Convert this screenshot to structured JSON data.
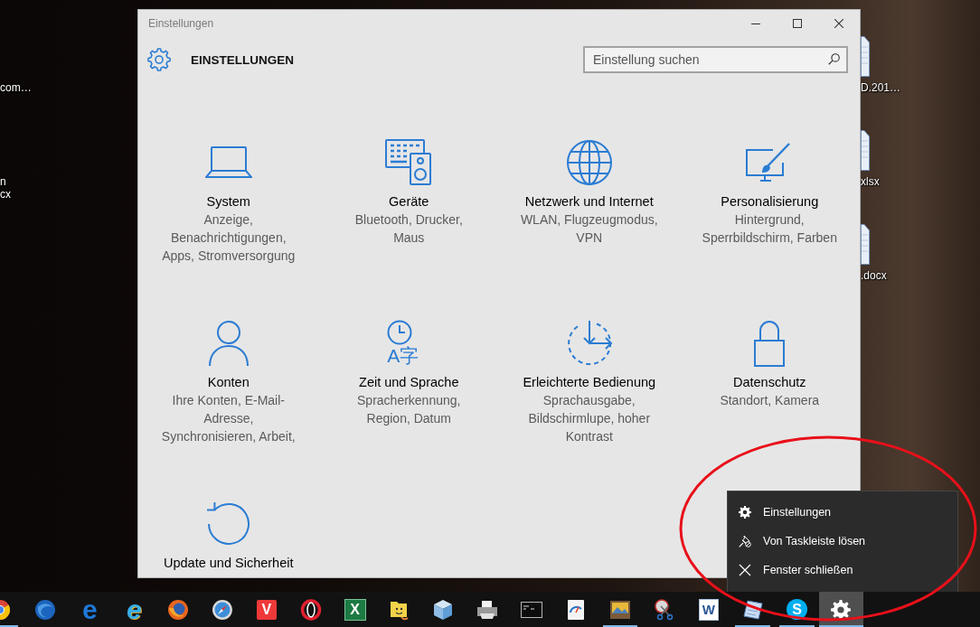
{
  "desktop": {
    "left_icons": [
      {
        "lines": [
          "com…"
        ]
      },
      {
        "lines": [
          "n",
          "cx"
        ]
      }
    ],
    "right_icons": [
      {
        "lines": [
          "D.201…"
        ]
      },
      {
        "lines": [
          "xlsx"
        ]
      },
      {
        "lines": [
          ".docx"
        ]
      }
    ]
  },
  "window": {
    "title": "Einstellungen",
    "heading": "EINSTELLUNGEN",
    "search": {
      "placeholder": "Einstellung suchen"
    },
    "categories": [
      {
        "kind": "system",
        "title": "System",
        "description": "Anzeige, Benachrichtigungen, Apps, Stromversorgung"
      },
      {
        "kind": "devices",
        "title": "Geräte",
        "description": "Bluetooth, Drucker, Maus"
      },
      {
        "kind": "network",
        "title": "Netzwerk und Internet",
        "description": "WLAN, Flugzeugmodus, VPN"
      },
      {
        "kind": "personalization",
        "title": "Personalisierung",
        "description": "Hintergrund, Sperrbildschirm, Farben"
      },
      {
        "kind": "accounts",
        "title": "Konten",
        "description": "Ihre Konten, E-Mail-Adresse, Synchronisieren, Arbeit,"
      },
      {
        "kind": "time",
        "title": "Zeit und Sprache",
        "icon_text": "A字",
        "description": "Spracherkennung, Region, Datum"
      },
      {
        "kind": "access",
        "title": "Erleichterte Bedienung",
        "description": "Sprachausgabe, Bildschirmlupe, hoher Kontrast"
      },
      {
        "kind": "privacy",
        "title": "Datenschutz",
        "description": "Standort, Kamera"
      },
      {
        "kind": "update",
        "title": "Update und Sicherheit"
      }
    ]
  },
  "context_menu": {
    "items": [
      {
        "kind": "gear",
        "label": "Einstellungen"
      },
      {
        "kind": "unpin",
        "label": "Von Taskleiste lösen"
      },
      {
        "kind": "close",
        "label": "Fenster schließen"
      }
    ]
  },
  "taskbar": {
    "items": [
      {
        "kind": "ball",
        "running": true,
        "selected": false
      },
      {
        "kind": "globe",
        "running": false,
        "selected": false
      },
      {
        "kind": "swoosh",
        "glyph": "e",
        "running": false,
        "selected": false
      },
      {
        "kind": "ringed",
        "glyph": "e",
        "running": false,
        "selected": false
      },
      {
        "kind": "fox",
        "running": false,
        "selected": false
      },
      {
        "kind": "compass",
        "running": false,
        "selected": false
      },
      {
        "kind": "vee",
        "glyph": "V",
        "running": false,
        "selected": false
      },
      {
        "kind": "ring",
        "running": false,
        "selected": false
      },
      {
        "kind": "sheet",
        "glyph": "X",
        "running": false,
        "selected": false
      },
      {
        "kind": "folder",
        "running": false,
        "selected": false
      },
      {
        "kind": "cube",
        "running": false,
        "selected": false
      },
      {
        "kind": "printer",
        "running": false,
        "selected": false
      },
      {
        "kind": "terminal",
        "running": false,
        "selected": false
      },
      {
        "kind": "gauge",
        "running": false,
        "selected": false
      },
      {
        "kind": "photo",
        "running": true,
        "selected": false
      },
      {
        "kind": "scissors",
        "running": false,
        "selected": false
      },
      {
        "kind": "doc",
        "glyph": "W",
        "running": false,
        "selected": false
      },
      {
        "kind": "tablet",
        "running": true,
        "selected": false
      },
      {
        "kind": "bubble",
        "glyph": "S",
        "running": true,
        "selected": false
      },
      {
        "kind": "gear",
        "running": true,
        "selected": true
      }
    ]
  },
  "annotation": {
    "kind": "ellipse"
  }
}
